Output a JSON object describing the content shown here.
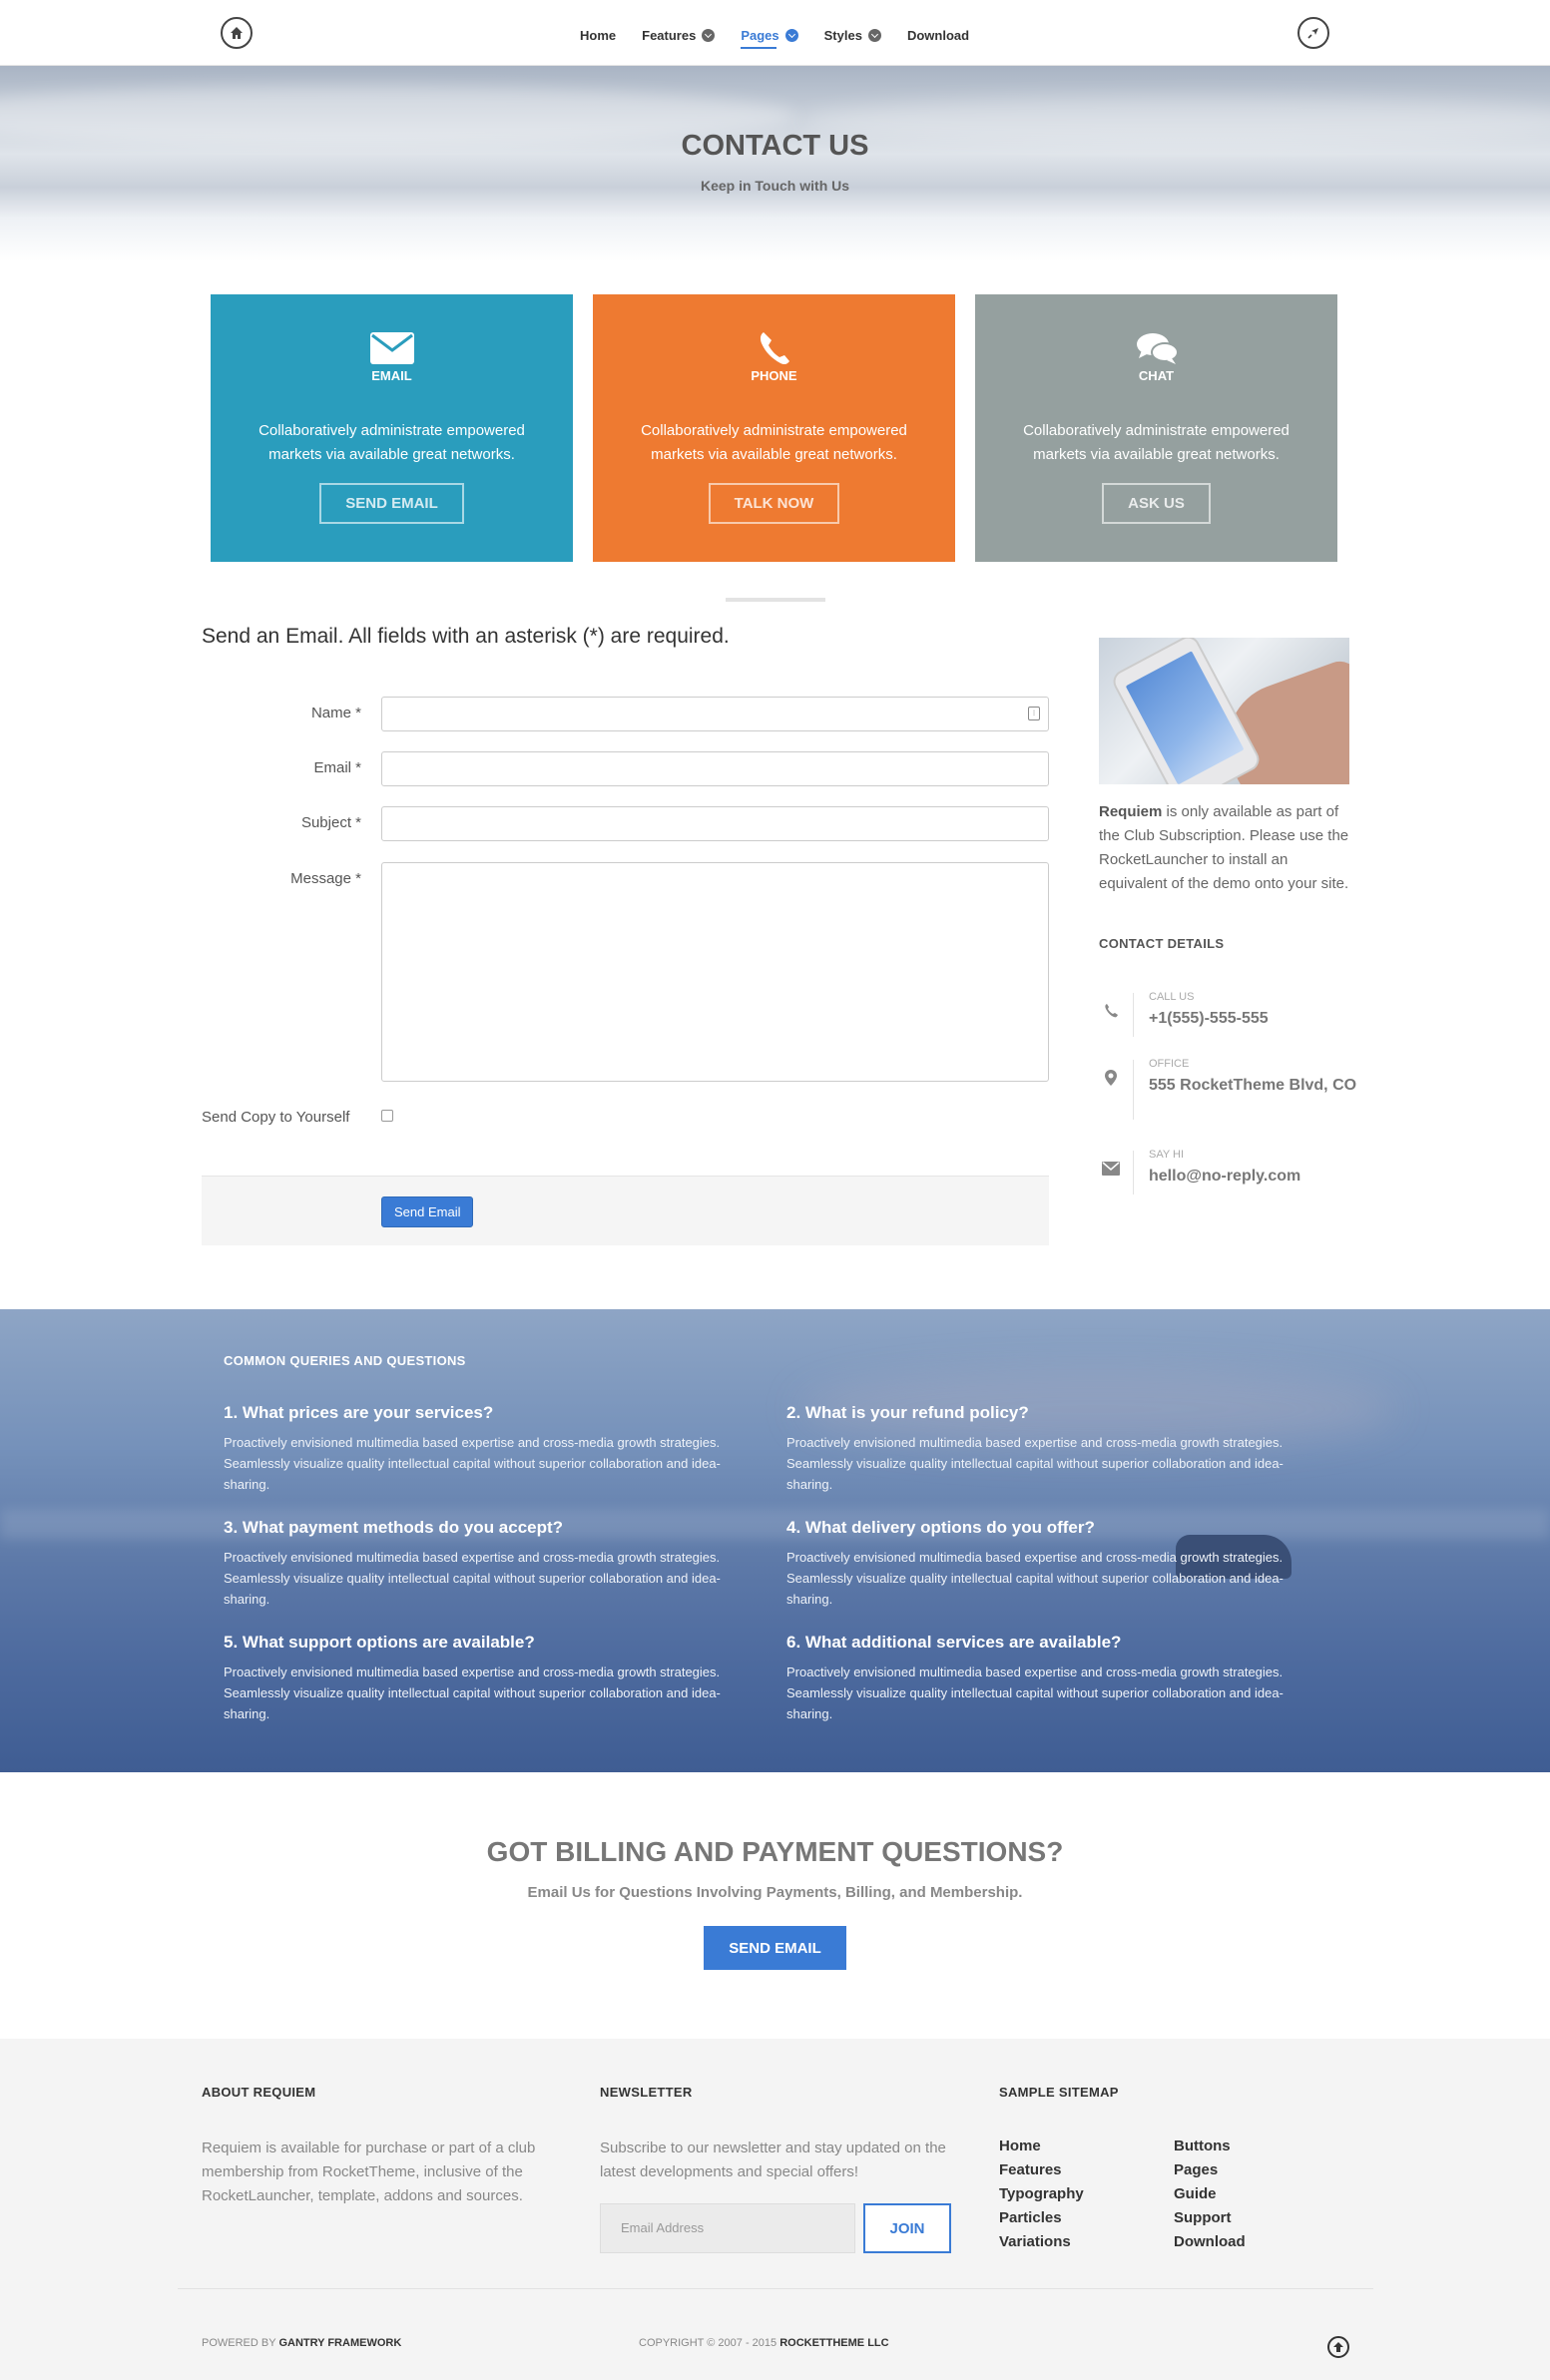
{
  "nav": {
    "home_icon": "home-icon",
    "rocket_icon": "rocket-icon",
    "items": [
      {
        "label": "Home",
        "dropdown": false,
        "active": false
      },
      {
        "label": "Features",
        "dropdown": true,
        "active": false
      },
      {
        "label": "Pages",
        "dropdown": true,
        "active": true
      },
      {
        "label": "Styles",
        "dropdown": true,
        "active": false
      },
      {
        "label": "Download",
        "dropdown": false,
        "active": false
      }
    ]
  },
  "hero": {
    "title": "CONTACT US",
    "subtitle": "Keep in Touch with Us"
  },
  "cards": [
    {
      "title": "EMAIL",
      "icon": "envelope-icon",
      "text": "Collaboratively administrate empowered markets via available great networks.",
      "button": "SEND EMAIL",
      "color": "#2a9dbd"
    },
    {
      "title": "PHONE",
      "icon": "phone-icon",
      "text": "Collaboratively administrate empowered markets via available great networks.",
      "button": "TALK NOW",
      "color": "#ee7a31"
    },
    {
      "title": "CHAT",
      "icon": "chat-icon",
      "text": "Collaboratively administrate empowered markets via available great networks.",
      "button": "ASK US",
      "color": "#95a09f"
    }
  ],
  "form": {
    "heading": "Send an Email. All fields with an asterisk (*) are required.",
    "name_label": "Name *",
    "email_label": "Email *",
    "subject_label": "Subject *",
    "message_label": "Message *",
    "name_value": "",
    "email_value": "",
    "subject_value": "",
    "message_value": "",
    "copy_label": "Send Copy to Yourself",
    "copy_checked": false,
    "submit_label": "Send Email"
  },
  "sidebar": {
    "intro_bold": "Requiem",
    "intro_rest": " is only available as part of the Club Subscription. Please use the RocketLauncher to install an equivalent of the demo onto your site.",
    "contact_heading": "CONTACT DETAILS",
    "details": [
      {
        "icon": "phone-icon",
        "label": "CALL US",
        "value": "+1(555)-555-555"
      },
      {
        "icon": "map-marker-icon",
        "label": "OFFICE",
        "value": "555 RocketTheme Blvd, CO"
      },
      {
        "icon": "envelope-icon",
        "label": "SAY HI",
        "value": "hello@no-reply.com"
      }
    ]
  },
  "faq": {
    "heading": "COMMON QUERIES AND QUESTIONS",
    "items": [
      {
        "q": "1. What prices are your services?",
        "a": "Proactively envisioned multimedia based expertise and cross-media growth strategies. Seamlessly visualize quality intellectual capital without superior collaboration and idea-sharing."
      },
      {
        "q": "2. What is your refund policy?",
        "a": "Proactively envisioned multimedia based expertise and cross-media growth strategies. Seamlessly visualize quality intellectual capital without superior collaboration and idea-sharing."
      },
      {
        "q": "3. What payment methods do you accept?",
        "a": "Proactively envisioned multimedia based expertise and cross-media growth strategies. Seamlessly visualize quality intellectual capital without superior collaboration and idea-sharing."
      },
      {
        "q": "4. What delivery options do you offer?",
        "a": "Proactively envisioned multimedia based expertise and cross-media growth strategies. Seamlessly visualize quality intellectual capital without superior collaboration and idea-sharing."
      },
      {
        "q": "5. What support options are available?",
        "a": "Proactively envisioned multimedia based expertise and cross-media growth strategies. Seamlessly visualize quality intellectual capital without superior collaboration and idea-sharing."
      },
      {
        "q": "6. What additional services are available?",
        "a": "Proactively envisioned multimedia based expertise and cross-media growth strategies. Seamlessly visualize quality intellectual capital without superior collaboration and idea-sharing."
      }
    ]
  },
  "cta": {
    "title": "GOT BILLING AND PAYMENT QUESTIONS?",
    "subtitle": "Email Us for Questions Involving Payments, Billing, and Membership.",
    "button": "SEND EMAIL"
  },
  "footer": {
    "about_heading": "ABOUT REQUIEM",
    "about_text": "Requiem is available for purchase or part of a club membership from RocketTheme, inclusive of the RocketLauncher, template, addons and sources.",
    "newsletter_heading": "NEWSLETTER",
    "newsletter_text": "Subscribe to our newsletter and stay updated on the latest developments and special offers!",
    "newsletter_placeholder": "Email Address",
    "join_label": "JOIN",
    "sitemap_heading": "SAMPLE SITEMAP",
    "sitemap_col1": [
      "Home",
      "Features",
      "Typography",
      "Particles",
      "Variations"
    ],
    "sitemap_col2": [
      "Buttons",
      "Pages",
      "Guide",
      "Support",
      "Download"
    ],
    "powered_prefix": "POWERED BY ",
    "powered_name": "GANTRY FRAMEWORK",
    "copyright_prefix": "COPYRIGHT © 2007 - 2015 ",
    "copyright_name": "ROCKETTHEME LLC",
    "top_icon": "arrow-up-icon"
  },
  "colors": {
    "accent": "#3a7bd5",
    "email_card": "#2a9dbd",
    "phone_card": "#ee7a31",
    "chat_card": "#95a09f"
  }
}
